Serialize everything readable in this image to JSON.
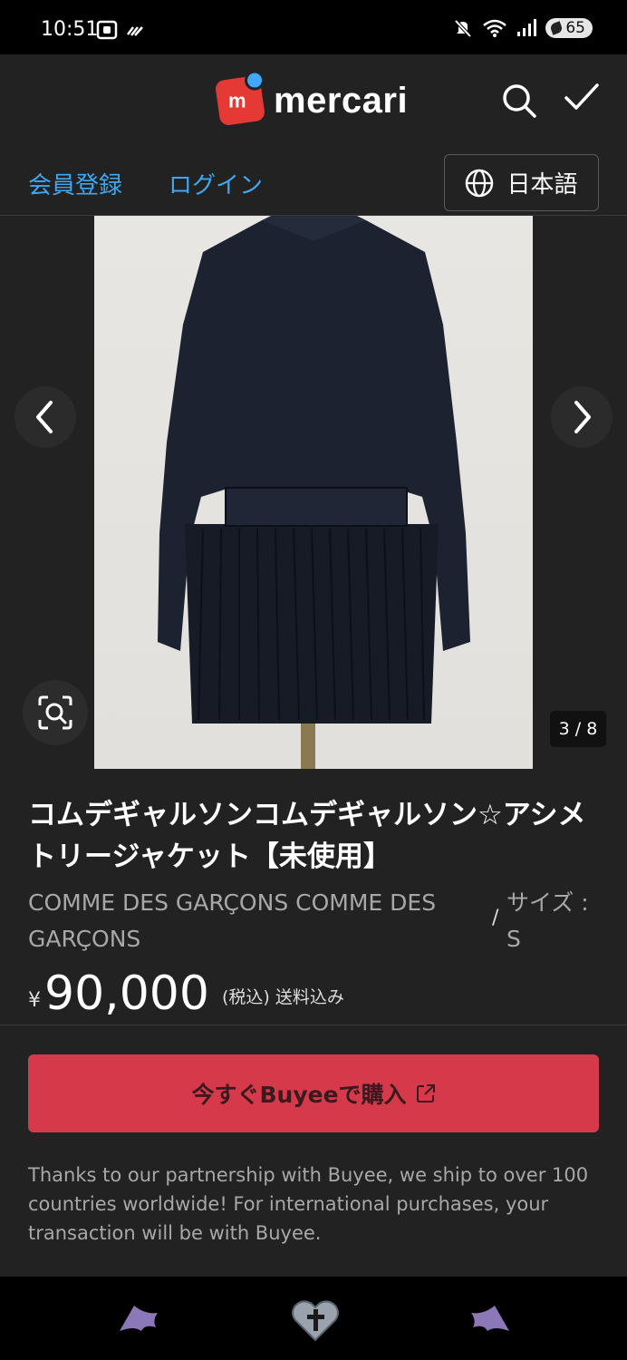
{
  "status_bar": {
    "time": "10:51",
    "battery": "65"
  },
  "header": {
    "logo_text": "mercari",
    "logo_mark": "m"
  },
  "auth": {
    "register": "会員登録",
    "login": "ログイン",
    "language": "日本語"
  },
  "carousel": {
    "counter": "3 / 8"
  },
  "product": {
    "title": "コムデギャルソンコムデギャルソン☆アシメトリージャケット【未使用】",
    "brand": "COMME DES GARÇONS COMME DES GARÇONS",
    "separator": "/",
    "size": "サイズ : S",
    "currency": "¥",
    "price": "90,000",
    "tax_note": "(税込) 送料込み"
  },
  "buy_button": {
    "label": "今すぐBuyeeで購入"
  },
  "note": "Thanks to our partnership with Buyee, we ship to over 100 countries worldwide! For international purchases, your transaction will be with Buyee.",
  "colors": {
    "background": "#222222",
    "link": "#3fa8f4",
    "buy_button": "#d63a4a",
    "logo_red": "#e53935",
    "logo_blue": "#40a9ff"
  }
}
